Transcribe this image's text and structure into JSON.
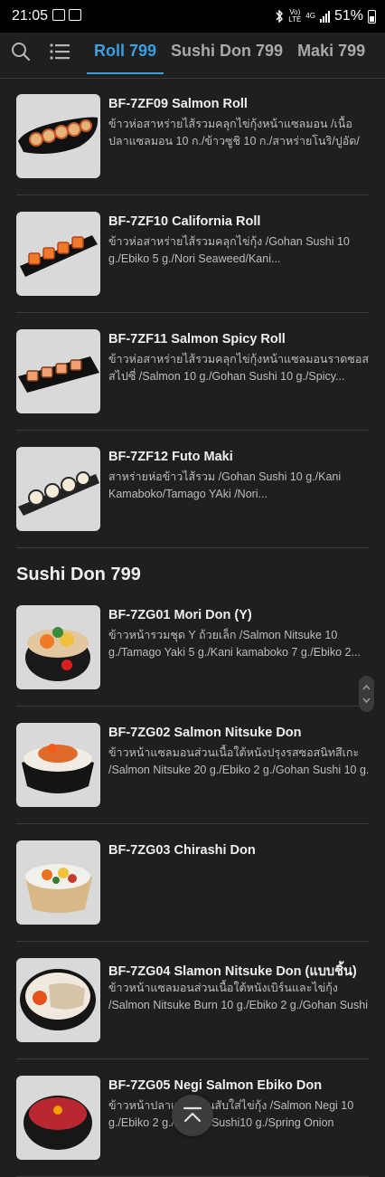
{
  "status_bar": {
    "time": "21:05",
    "network_type": "Vo) LTE",
    "network_gen": "4G",
    "battery": "51%"
  },
  "nav": {
    "tabs": [
      {
        "label": "Roll 799",
        "active": true
      },
      {
        "label": "Sushi Don 799",
        "active": false
      },
      {
        "label": "Maki 799",
        "active": false
      }
    ]
  },
  "sections": [
    {
      "title": "",
      "items": [
        {
          "code": "BF-7ZF09 Salmon Roll",
          "description": "ข้าวห่อสาหร่ายไส้รวมคลุกไข่กุ้งหน้าแซลมอน /เนื้อปลาแซลมอน 10 ก./ข้าวซูชิ 10 ก./สาหร่ายโนริ/ปูอัด/ไข่หวาน"
        },
        {
          "code": "BF-7ZF10 California Roll",
          "description": "ข้าวห่อสาหร่ายไส้รวมคลุกไข่กุ้ง /Gohan Sushi 10 g./Ebiko 5 g./Nori Seaweed/Kani..."
        },
        {
          "code": "BF-7ZF11 Salmon Spicy Roll",
          "description": "ข้าวห่อสาหร่ายไส้รวมคลุกไข่กุ้งหน้าแซลมอนราดซอสสไปซี่ /Salmon 10 g./Gohan Sushi 10 g./Spicy..."
        },
        {
          "code": "BF-7ZF12 Futo Maki",
          "description": "สาหร่ายห่อข้าวไส้รวม /Gohan Sushi 10 g./Kani Kamaboko/Tamago YAki /Nori..."
        }
      ]
    },
    {
      "title": "Sushi Don 799",
      "items": [
        {
          "code": "BF-7ZG01 Mori Don (Y)",
          "description": "ข้าวหน้ารวมชุด Y ถ้วยเล็ก /Salmon Nitsuke 10 g./Tamago Yaki 5 g./Kani kamaboko 7 g./Ebiko 2..."
        },
        {
          "code": "BF-7ZG02 Salmon Nitsuke Don",
          "description": "ข้าวหน้าแซลมอนส่วนเนื้อใต้หนังปรุงรสซอสนิทสึเกะ /Salmon Nitsuke 20 g./Ebiko 2 g./Gohan Sushi 10 g."
        },
        {
          "code": "BF-7ZG03 Chirashi Don",
          "description": ""
        },
        {
          "code": "BF-7ZG04 Slamon Nitsuke Don (แบบชิ้น)",
          "description": "ข้าวหน้าแซลมอนส่วนเนื้อใต้หนังเบิร์นและไข่กุ้ง /Salmon Nitsuke Burn 10 g./Ebiko 2 g./Gohan Sushi 10..."
        },
        {
          "code": "BF-7ZG05 Negi Salmon Ebiko Don",
          "description": "ข้าวหน้าปลาแซลมอนสับใส่ไข่กุ้ง /Salmon Negi 10 g./Ebiko 2 g./Gohan Sushi10 g./Spring Onion"
        }
      ]
    }
  ],
  "colors": {
    "background": "#1f1f1f",
    "accent": "#3aa0e0",
    "divider": "#3a3a3a"
  },
  "icons": {
    "search": "search-icon",
    "menu": "list-icon",
    "scroll_top": "chevron-up-icon"
  }
}
